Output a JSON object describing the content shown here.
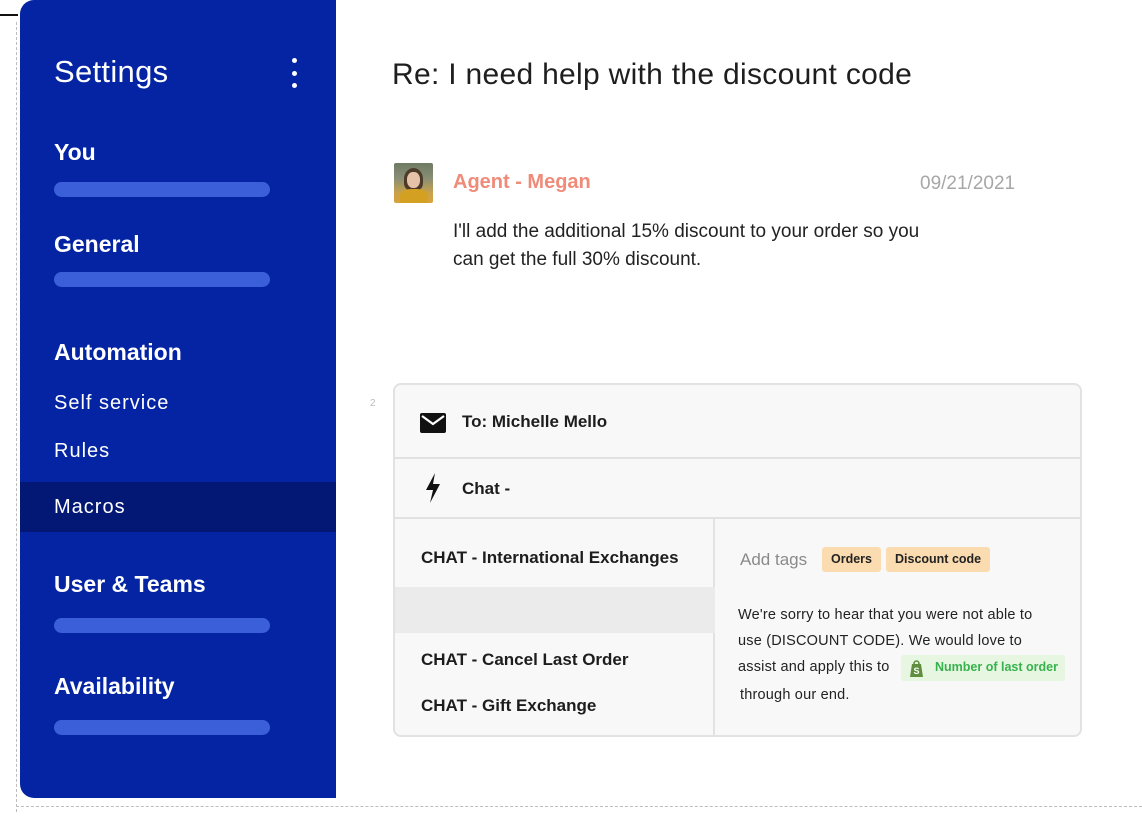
{
  "sidebar": {
    "title": "Settings",
    "sections": {
      "you": "You",
      "general": "General",
      "automation": "Automation",
      "user_teams": "User & Teams",
      "availability": "Availability"
    },
    "automation_items": {
      "self_service": "Self service",
      "rules": "Rules",
      "macros": "Macros"
    },
    "active_item": "Macros"
  },
  "ticket": {
    "title": "Re: I need help with the discount code",
    "message": {
      "author": "Agent - Megan",
      "date": "09/21/2021",
      "body": "I'll add the additional 15% discount to your order so you can get the full 30% discount."
    }
  },
  "composer": {
    "gutter_number": "2",
    "to_label": "To: Michelle Mello",
    "channel_label": "Chat -",
    "macros": [
      "CHAT - International Exchanges",
      "",
      "CHAT - Cancel Last Order",
      "CHAT - Gift Exchange"
    ],
    "add_tags_label": "Add tags",
    "tags": [
      "Orders",
      "Discount code"
    ],
    "reply": {
      "line1": "We're sorry to hear that you were not able to",
      "line2": "use (DISCOUNT CODE). We would love to",
      "line3": "assist and apply this to",
      "line4": "through our end.",
      "variable": "Number of last order"
    }
  },
  "icons": {
    "menu": "kebab-menu-icon",
    "mail": "mail-icon",
    "chat": "lightning-bolt-icon",
    "shop": "shopify-bag-icon"
  },
  "colors": {
    "sidebar_bg": "#0424a3",
    "sidebar_active": "#021874",
    "agent_name": "#f08b79",
    "tag_bg": "#fbdcb0",
    "variable_text": "#37b24d"
  }
}
